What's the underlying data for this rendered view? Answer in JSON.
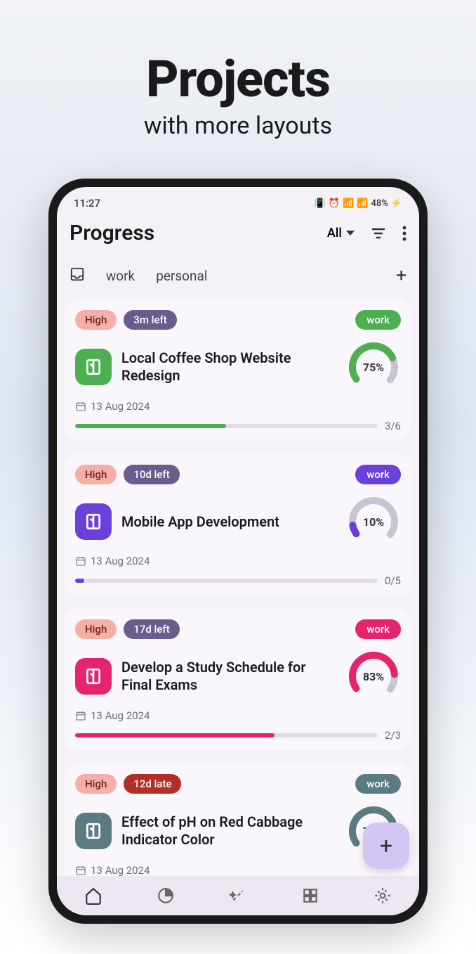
{
  "hero": {
    "title": "Projects",
    "subtitle": "with more layouts"
  },
  "statusbar": {
    "time": "11:27",
    "battery": "48%"
  },
  "header": {
    "title": "Progress",
    "filter": "All"
  },
  "tabs": {
    "item1": "work",
    "item2": "personal"
  },
  "projects": [
    {
      "priority": "High",
      "time": "3m left",
      "tag": "work",
      "title": "Local Coffee Shop Website Redesign",
      "date": "13 Aug 2024",
      "percent": "75%",
      "count": "3/6",
      "color": "#4CAF50",
      "tagColor": "#4CAF50",
      "barPct": 50,
      "gaugePct": 75
    },
    {
      "priority": "High",
      "time": "10d left",
      "tag": "work",
      "title": "Mobile App Development",
      "date": "13 Aug 2024",
      "percent": "10%",
      "count": "0/5",
      "color": "#6b3fd9",
      "tagColor": "#6b3fd9",
      "barPct": 3,
      "gaugePct": 10
    },
    {
      "priority": "High",
      "time": "17d left",
      "tag": "work",
      "title": "Develop a Study Schedule for Final Exams",
      "date": "13 Aug 2024",
      "percent": "83%",
      "count": "2/3",
      "color": "#e6236d",
      "tagColor": "#e6236d",
      "barPct": 66,
      "gaugePct": 83
    },
    {
      "priority": "High",
      "time": "12d late",
      "tag": "work",
      "title": "Effect of pH on Red Cabbage Indicator Color",
      "date": "13 Aug 2024",
      "percent": "75%",
      "count": "",
      "color": "#5b7b82",
      "tagColor": "#5b7b82",
      "barPct": 0,
      "gaugePct": 75,
      "late": true
    }
  ]
}
